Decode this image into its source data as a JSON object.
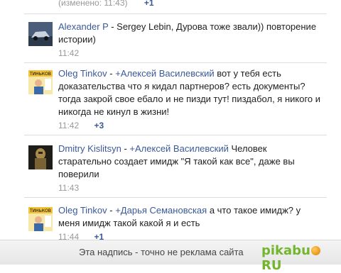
{
  "top_row": {
    "time": "(изменено: 11:43)",
    "plus": "+1"
  },
  "comments": [
    {
      "author": "Alexander P",
      "sep": " - ",
      "reply_to": "",
      "text": "Sergey Lebin, Дурова тоже звали)) повторение истории)",
      "time": "11:42",
      "plus": ""
    },
    {
      "author": "Oleg Tinkov",
      "sep": " - ",
      "reply_to": "+Алексей Василевский",
      "text": " вот у тебя есть доказательства что я кидал партнеров? есть документы? тогда закрой свое ебало и не пизди тут! пиздабол, я никого и никогда не кинул в жизни!",
      "time": "11:42",
      "plus": "+3"
    },
    {
      "author": "Dmitry Kislitsyn",
      "sep": " - ",
      "reply_to": "+Алексей Василевский",
      "text": " Человек старательно создает имидж \"Я такой как все\", даже вы поверили",
      "time": "11:43",
      "plus": ""
    },
    {
      "author": "Oleg Tinkov",
      "sep": " - ",
      "reply_to": "+Дарья Семановская",
      "text": " а что такое имидж? у меня имидж такой какой я и есть",
      "time": "11:44",
      "plus": "+1"
    }
  ],
  "footer": {
    "text": "Эта надпись - точно не реклама сайта",
    "logo_part1": "pikab",
    "logo_part2": "u",
    "logo_part3": "RU"
  },
  "icons": {
    "avatar_alexander": "car-photo-avatar",
    "avatar_tinkov": "book-cover-avatar",
    "avatar_dmitry": "knight-figure-avatar"
  }
}
